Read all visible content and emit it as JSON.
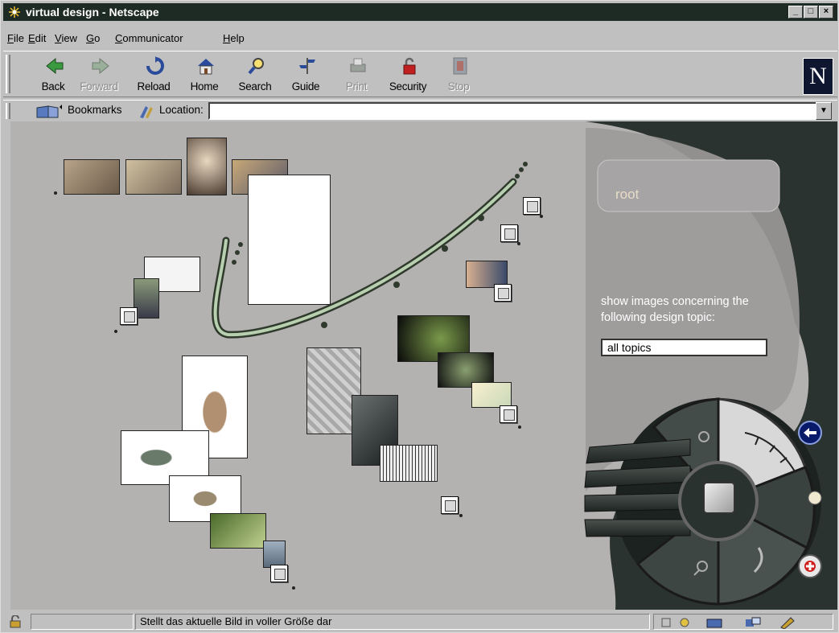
{
  "window": {
    "title": "virtual design - Netscape"
  },
  "menu": [
    "File",
    "Edit",
    "View",
    "Go",
    "Communicator",
    "Help"
  ],
  "toolbar": {
    "buttons": [
      {
        "label": "Back",
        "enabled": true,
        "icon": "back-arrow-icon"
      },
      {
        "label": "Forward",
        "enabled": false,
        "icon": "forward-arrow-icon"
      },
      {
        "label": "Reload",
        "enabled": true,
        "icon": "reload-icon"
      },
      {
        "label": "Home",
        "enabled": true,
        "icon": "home-icon"
      },
      {
        "label": "Search",
        "enabled": true,
        "icon": "search-icon"
      },
      {
        "label": "Guide",
        "enabled": true,
        "icon": "guide-icon"
      },
      {
        "label": "Print",
        "enabled": false,
        "icon": "print-icon"
      },
      {
        "label": "Security",
        "enabled": true,
        "icon": "lock-icon"
      },
      {
        "label": "Stop",
        "enabled": false,
        "icon": "stop-icon"
      }
    ],
    "logo": "N"
  },
  "location": {
    "bookmarks_label": "Bookmarks",
    "location_label": "Location:",
    "url": ""
  },
  "page": {
    "root_label": "root",
    "topic_prompt": "show images concerning the following design topic:",
    "topic_value": "all topics"
  },
  "status": {
    "text": "Stellt das aktuelle Bild in voller Größe dar"
  },
  "colors": {
    "titlebar": "#1e2a24",
    "chrome": "#c0c0c0",
    "content_bg": "#b4b1b1",
    "panel": "#2b3330"
  }
}
